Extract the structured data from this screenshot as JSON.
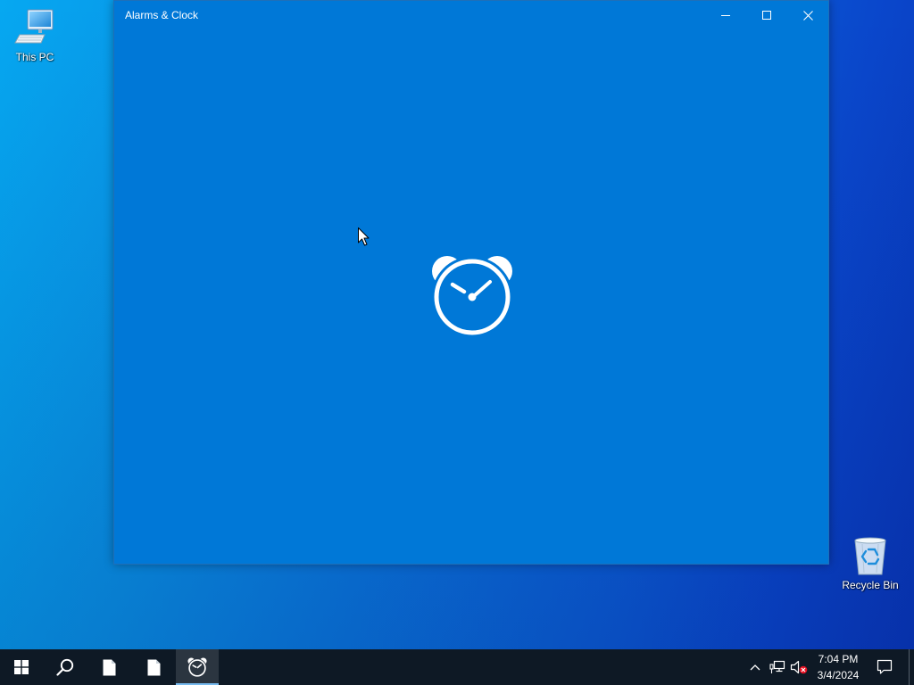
{
  "desktop": {
    "icons": [
      {
        "label": "This PC",
        "icon": "computer-icon"
      },
      {
        "label": "Recycle Bin",
        "icon": "recycle-bin-icon"
      }
    ]
  },
  "window": {
    "title": "Alarms & Clock",
    "controls": [
      "minimize-icon",
      "maximize-icon",
      "close-icon"
    ],
    "splash_icon": "alarm-clock-icon"
  },
  "taskbar": {
    "items": [
      {
        "icon": "windows-logo-icon"
      },
      {
        "icon": "search-icon"
      },
      {
        "icon": "document-icon"
      },
      {
        "icon": "document-icon"
      },
      {
        "icon": "alarm-clock-icon",
        "active": true
      }
    ],
    "tray": {
      "icons": [
        "chevron-up-icon",
        "network-icon",
        "volume-muted-icon"
      ],
      "time": "7:04 PM",
      "date": "3/4/2024",
      "notification_icon": "notification-icon"
    }
  },
  "colors": {
    "window_accent": "#0078d7",
    "taskbar": "#0e1925",
    "active_underline": "#76b9ed",
    "mute_badge": "#e81123"
  }
}
